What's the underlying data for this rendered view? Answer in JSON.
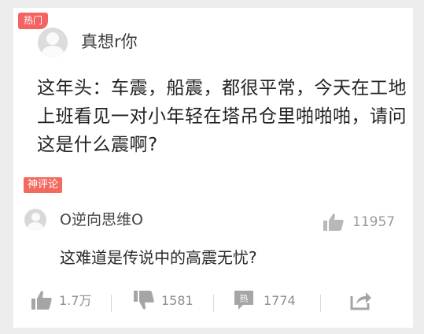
{
  "post": {
    "hot_badge": "热门",
    "author": "真想r你",
    "text": "这年头：车震，船震，都很平常，今天在工地上班看见一对小年轻在塔吊仓里啪啪啪，请问这是什么震啊?"
  },
  "comment": {
    "tag": "神评论",
    "author": "O逆向思维O",
    "likes": "11957",
    "text": "这难道是传说中的高震无忧?"
  },
  "actions": {
    "like_count": "1.7万",
    "dislike_count": "1581",
    "hot_icon_label": "热",
    "comment_count": "1774"
  },
  "colors": {
    "badge": "#f36360",
    "icon": "#9b9b9b",
    "background": "#ededed"
  }
}
